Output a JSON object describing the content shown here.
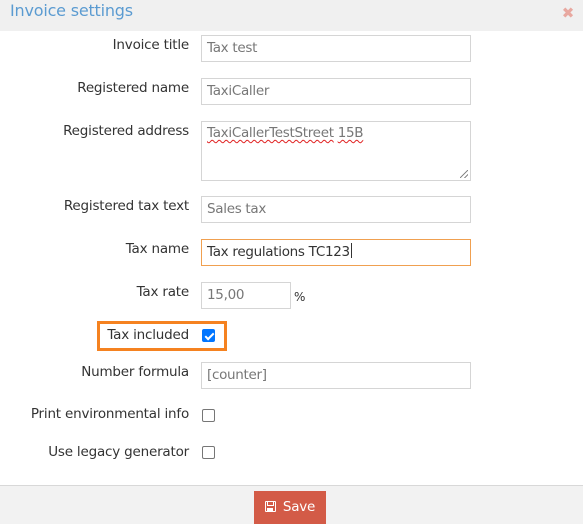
{
  "dialog": {
    "title": "Invoice settings",
    "close_icon": "close-x-icon"
  },
  "form": {
    "invoice_title": {
      "label": "Invoice title",
      "value": "Tax test"
    },
    "registered_name": {
      "label": "Registered name",
      "value": "TaxiCaller"
    },
    "registered_address": {
      "label": "Registered address",
      "value_words": [
        "TaxiCallerTestStreet",
        "15B"
      ]
    },
    "registered_tax_text": {
      "label": "Registered tax text",
      "value": "Sales tax"
    },
    "tax_name": {
      "label": "Tax name",
      "value": "Tax regulations TC123",
      "focused": true
    },
    "tax_rate": {
      "label": "Tax rate",
      "value": "15,00",
      "unit": "%"
    },
    "tax_included": {
      "label": "Tax included",
      "checked": true,
      "highlighted": true
    },
    "number_formula": {
      "label": "Number formula",
      "value": "[counter]"
    },
    "print_environmental_info": {
      "label": "Print environmental info",
      "checked": false
    },
    "use_legacy_generator": {
      "label": "Use legacy generator",
      "checked": false
    }
  },
  "footer": {
    "save_label": "Save",
    "save_icon": "floppy-disk-icon"
  },
  "colors": {
    "title": "#5b9bd1",
    "save_button": "#d35b47",
    "highlight": "#f58220",
    "focus_border": "#f0a050",
    "checkbox_checked": "#0075ff"
  }
}
